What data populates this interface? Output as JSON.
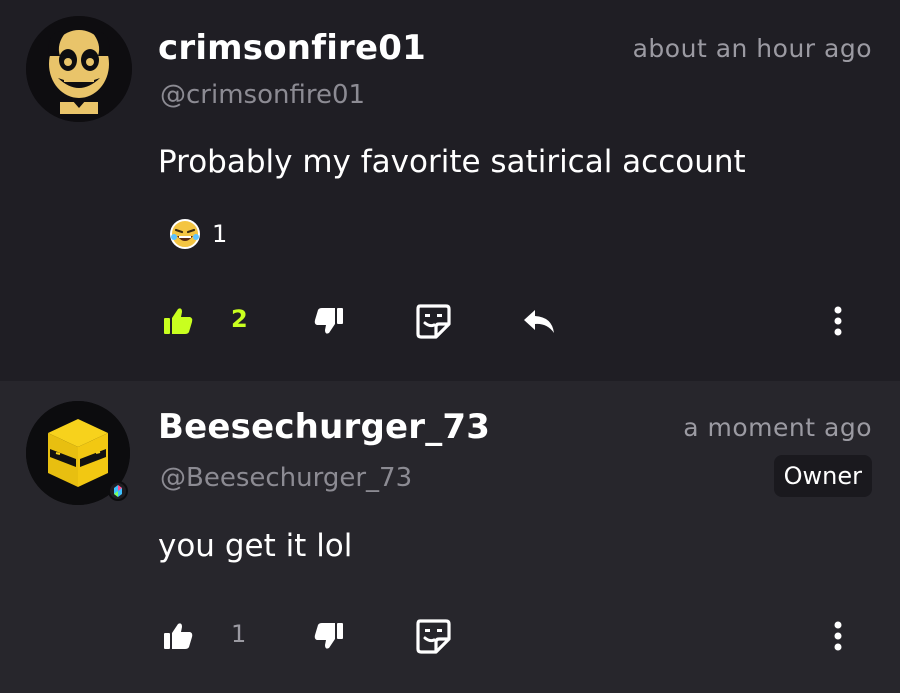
{
  "comments": [
    {
      "username": "crimsonfire01",
      "handle": "@crimsonfire01",
      "time": "about an hour ago",
      "text": "Probably my favorite satirical account",
      "reaction": {
        "icon": "laughing-emoji-icon",
        "count": "1"
      },
      "likes": "2",
      "liked": true,
      "accent_color": "#c9ff1f"
    },
    {
      "username": "Beesechurger_73",
      "handle": "@Beesechurger_73",
      "time": "a moment ago",
      "badge": "Owner",
      "text": "you get it lol",
      "likes": "1",
      "liked": false
    }
  ],
  "icons": {
    "like": "thumbs-up-icon",
    "dislike": "thumbs-down-icon",
    "sticker": "sticker-icon",
    "reply": "reply-arrow-icon",
    "more": "more-vertical-icon"
  },
  "colors": {
    "background": "#1f1e24",
    "background_highlight": "#27262c",
    "muted_text": "#8c8b93",
    "accent": "#c9ff1f"
  }
}
